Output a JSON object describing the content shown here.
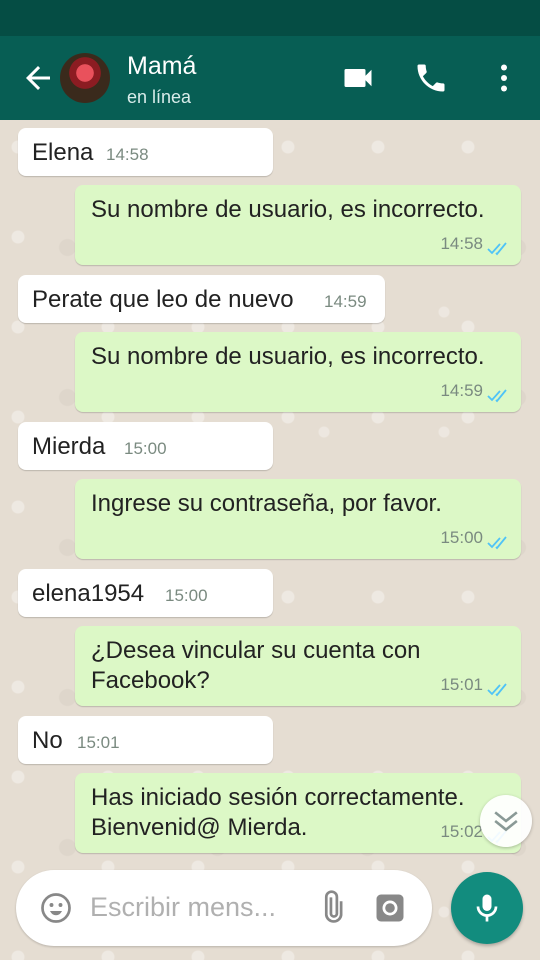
{
  "header": {
    "contact_name": "Mamá",
    "status": "en línea",
    "icons": [
      "back-arrow-icon",
      "video-call-icon",
      "phone-icon",
      "more-vert-icon"
    ]
  },
  "messages": [
    {
      "direction": "in",
      "text": "Elena",
      "time": "14:58"
    },
    {
      "direction": "out",
      "text": "Su nombre de usuario, es incorrecto.",
      "time": "14:58",
      "read": true
    },
    {
      "direction": "in",
      "text": "Perate que leo de nuevo",
      "time": "14:59"
    },
    {
      "direction": "out",
      "text": "Su nombre de usuario, es incorrecto.",
      "time": "14:59",
      "read": true
    },
    {
      "direction": "in",
      "text": "Mierda",
      "time": "15:00"
    },
    {
      "direction": "out",
      "text": "Ingrese su contraseña, por favor.",
      "time": "15:00",
      "read": true
    },
    {
      "direction": "in",
      "text": "elena1954",
      "time": "15:00"
    },
    {
      "direction": "out",
      "text": "¿Desea vincular su cuenta con Facebook?",
      "time": "15:01",
      "read": true
    },
    {
      "direction": "in",
      "text": "No",
      "time": "15:01"
    },
    {
      "direction": "out",
      "text": "Has iniciado sesión correctamente. Bienvenid@ Mierda.",
      "time": "15:02",
      "read": true
    }
  ],
  "composer": {
    "placeholder": "Escribir mens..."
  },
  "colors": {
    "header": "#075e54",
    "status_bar": "#054d44",
    "outgoing_bubble": "#dcf8c6",
    "incoming_bubble": "#ffffff",
    "read_tick": "#4fc3f7",
    "mic_button": "#128c7e"
  }
}
